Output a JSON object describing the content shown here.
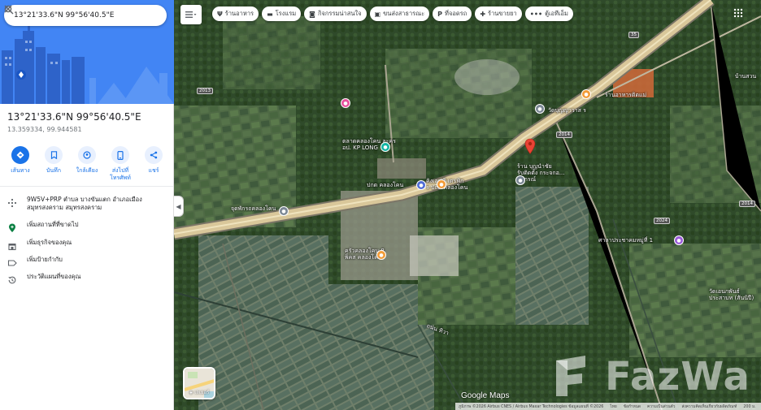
{
  "search": {
    "query": "13°21'33.6\"N 99°56'40.5\"E"
  },
  "place": {
    "title": "13°21'33.6\"N 99°56'40.5\"E",
    "decimal": "13.359334, 99.944581"
  },
  "actions": [
    {
      "label": "เส้นทาง",
      "icon": "directions-icon"
    },
    {
      "label": "บันทึก",
      "icon": "bookmark-icon"
    },
    {
      "label": "ใกล้เคียง",
      "icon": "nearby-icon"
    },
    {
      "label": "ส่งไปที่\nโทรศัพท์",
      "icon": "phone-icon"
    },
    {
      "label": "แชร์",
      "icon": "share-icon"
    }
  ],
  "info": [
    {
      "text": "9W5V+PRP ตำบล บางขันแตก อำเภอเมือง สมุทรสงคราม สมุทรสงคราม",
      "icon": "plus-code-icon"
    },
    {
      "text": "เพิ่มสถานที่ที่ขาดไป",
      "icon": "add-place-icon"
    },
    {
      "text": "เพิ่มธุรกิจของคุณ",
      "icon": "business-icon"
    },
    {
      "text": "เพิ่มป้ายกำกับ",
      "icon": "label-icon"
    },
    {
      "text": "ประวัติแผนที่ของคุณ",
      "icon": "history-icon"
    }
  ],
  "chips": [
    {
      "label": "ร้านอาหาร",
      "icon": "restaurant-icon"
    },
    {
      "label": "โรงแรม",
      "icon": "hotel-icon"
    },
    {
      "label": "กิจกรรมน่าสนใจ",
      "icon": "camera-icon"
    },
    {
      "label": "ขนส่งสาธารณะ",
      "icon": "transit-icon"
    },
    {
      "label": "ที่จอดรถ",
      "icon": "parking-icon"
    },
    {
      "label": "ร้านขายยา",
      "icon": "pharmacy-icon"
    },
    {
      "label": "ตู้เอทีเอ็ม",
      "icon": "atm-icon"
    }
  ],
  "map_labels": {
    "kp_market": "ตลาดคลองโคน ละคร\nอป. KP LONG",
    "bridge": "จุดพักรถคลองโคน",
    "town": "ปกด คลองโคน",
    "shop": "ร้าน บุญนำชัย\nรับติดตั้ง กระจกอ...\nอุปกรณ์",
    "cafe": "ครัวคลองโคน 8\nพ็คส คลองโคน",
    "temple": "วัดบุญญาวาส ร",
    "hall": "ศาลาประชาคมหมู่ที่ 1",
    "store": "คิงเอฟพี เดรฟัก\nร ปกด คลองโคน",
    "school": "วัดเอนกพันธ์\nประสาบท (สันนิปี)",
    "village": "บ้านสวน",
    "road_name": "ถนน ทิวา",
    "shop_top": "ร้านอาหารติดแม่"
  },
  "road_shields": [
    "35",
    "2013",
    "2014",
    "2024",
    "2014"
  ],
  "layers": {
    "label": "เลเยอร์"
  },
  "branding": {
    "google": "Google Maps",
    "attribution": "ภูมิภาพ ©2026 Airbus CNES / Airbus Maxar Technologies ข้อมูลแผนที่ ©2026",
    "links": [
      "ไทย",
      "ข้อกำหนด",
      "ความเป็นส่วนตัว",
      "ส่งความคิดเห็นเกี่ยวกับผลิตภัณฑ์",
      "200 ม."
    ],
    "watermark": "FazWa"
  },
  "colors": {
    "accent": "#1a73e8",
    "pin": "#ea4335",
    "road": "#d9c79a"
  }
}
